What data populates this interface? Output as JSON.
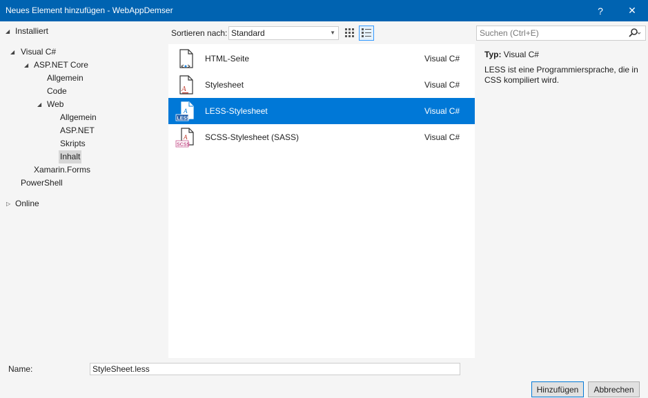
{
  "window": {
    "title": "Neues Element hinzufügen - WebAppDemser",
    "help_label": "?",
    "close_label": "✕"
  },
  "tree": {
    "installed": "Installiert",
    "visual_csharp": "Visual C#",
    "aspnet_core": "ASP.NET Core",
    "allgemein": "Allgemein",
    "code": "Code",
    "web": "Web",
    "web_allgemein": "Allgemein",
    "web_aspnet": "ASP.NET",
    "web_skripts": "Skripts",
    "web_inhalt": "Inhalt",
    "xamarin": "Xamarin.Forms",
    "powershell": "PowerShell",
    "online": "Online"
  },
  "toolbar": {
    "sort_label": "Sortieren nach:",
    "sort_value": "Standard",
    "search_placeholder": "Suchen (Ctrl+E)"
  },
  "items": [
    {
      "name": "HTML-Seite",
      "lang": "Visual C#",
      "icon": "html-page-icon"
    },
    {
      "name": "Stylesheet",
      "lang": "Visual C#",
      "icon": "stylesheet-icon"
    },
    {
      "name": "LESS-Stylesheet",
      "lang": "Visual C#",
      "icon": "less-stylesheet-icon"
    },
    {
      "name": "SCSS-Stylesheet (SASS)",
      "lang": "Visual C#",
      "icon": "scss-stylesheet-icon"
    }
  ],
  "details": {
    "type_label": "Typ:",
    "type_value": "Visual C#",
    "description": "LESS ist eine Programmiersprache, die in CSS kompiliert wird."
  },
  "bottom": {
    "name_label": "Name:",
    "name_value": "StyleSheet.less",
    "add_label": "Hinzufügen",
    "cancel_label": "Abbrechen"
  },
  "colors": {
    "titlebar": "#0063b1",
    "selection": "#0078d7",
    "less_badge": "#1d5aa8",
    "scss_badge": "#c6538c"
  }
}
